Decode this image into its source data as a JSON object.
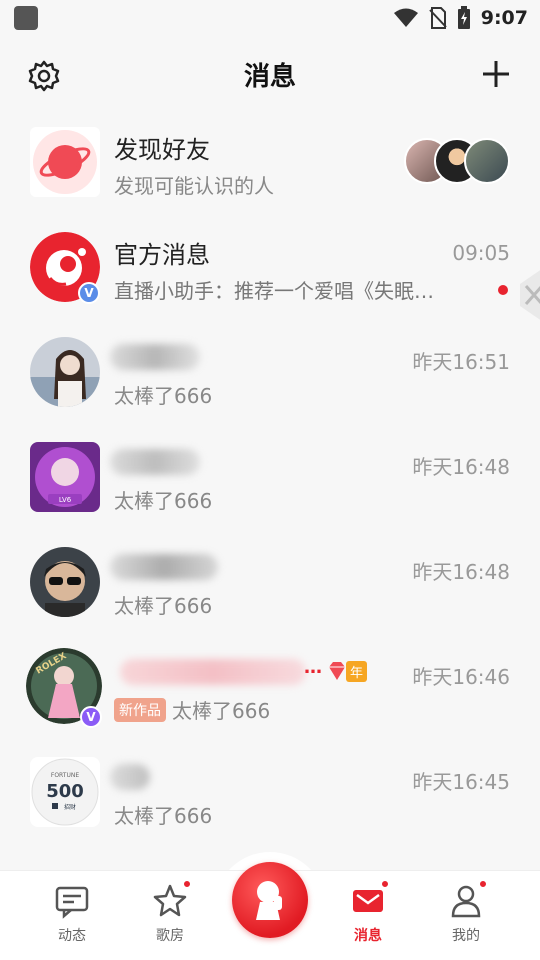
{
  "status_bar": {
    "time": "9:07"
  },
  "header": {
    "title": "消息"
  },
  "rows": [
    {
      "title": "发现好友",
      "subtitle": "发现可能认识的人"
    },
    {
      "title": "官方消息",
      "subtitle": "直播小助手：推荐一个爱唱《失眠…",
      "time": "09:05"
    },
    {
      "subtitle": "太棒了666",
      "time": "昨天16:51"
    },
    {
      "subtitle": "太棒了666",
      "time": "昨天16:48"
    },
    {
      "subtitle": "太棒了666",
      "time": "昨天16:48"
    },
    {
      "subtitle": "太棒了666",
      "time": "昨天16:46",
      "tag": "新作品",
      "name_suffix": "…",
      "vip_year": "年",
      "avatar_text": "ROLEX"
    },
    {
      "subtitle": "太棒了666",
      "time": "昨天16:45",
      "avatar_text": "500",
      "avatar_top": "FORTUNE",
      "avatar_brand": "招财"
    }
  ],
  "nav": [
    {
      "label": "动态",
      "icon": "feed-icon"
    },
    {
      "label": "歌房",
      "icon": "star-icon"
    },
    {
      "label": "消息",
      "icon": "mail-icon"
    },
    {
      "label": "我的",
      "icon": "profile-icon"
    }
  ],
  "colors": {
    "accent": "#e8242f",
    "official": "#e8242f",
    "vip_badge": "#5b8de8"
  }
}
